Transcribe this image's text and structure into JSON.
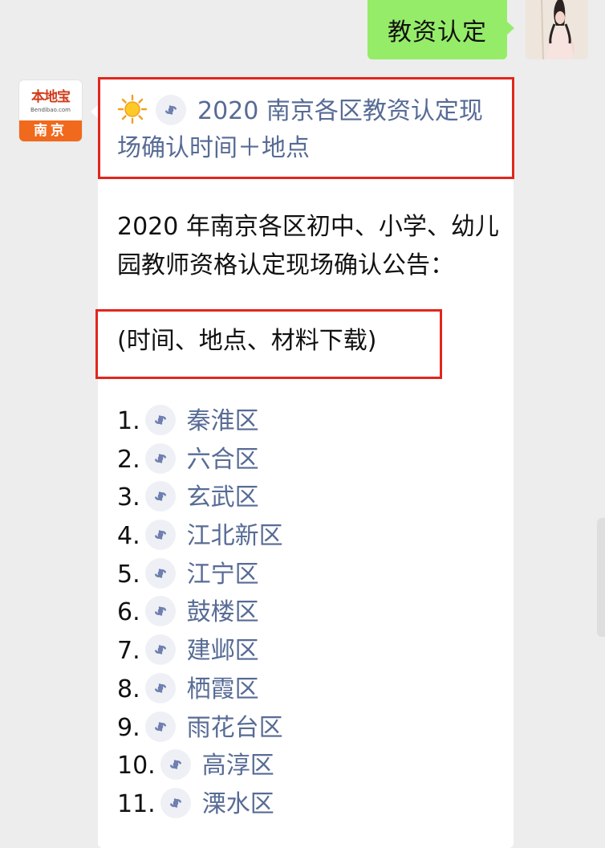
{
  "outgoing_message": {
    "text": "教资认定"
  },
  "account_avatar": {
    "brand_name": "本地宝",
    "brand_url": "Bendibao.com",
    "city": "南京"
  },
  "article_message": {
    "headline": "2020 南京各区教资认定现场确认时间＋地点",
    "intro": "2020 年南京各区初中、小学、幼儿园教师资格认定现场确认公告：",
    "subheading": "(时间、地点、材料下载)",
    "districts": [
      {
        "num": "1.",
        "name": "秦淮区"
      },
      {
        "num": "2.",
        "name": "六合区"
      },
      {
        "num": "3.",
        "name": "玄武区"
      },
      {
        "num": "4.",
        "name": "江北新区"
      },
      {
        "num": "5.",
        "name": "江宁区"
      },
      {
        "num": "6.",
        "name": "鼓楼区"
      },
      {
        "num": "7.",
        "name": "建邺区"
      },
      {
        "num": "8.",
        "name": "栖霞区"
      },
      {
        "num": "9.",
        "name": "雨花台区"
      },
      {
        "num": "10.",
        "name": "高淳区"
      },
      {
        "num": "11.",
        "name": "溧水区"
      }
    ]
  },
  "colors": {
    "outgoing_bubble": "#95ec69",
    "link_text": "#576b95",
    "highlight_frame": "#e1261c",
    "chat_background": "#ededed",
    "brand_red": "#d13b19",
    "brand_orange": "#f0691c"
  },
  "icons": {
    "headline_emoji": "sun-icon",
    "mini_program_link": "link-icon"
  }
}
